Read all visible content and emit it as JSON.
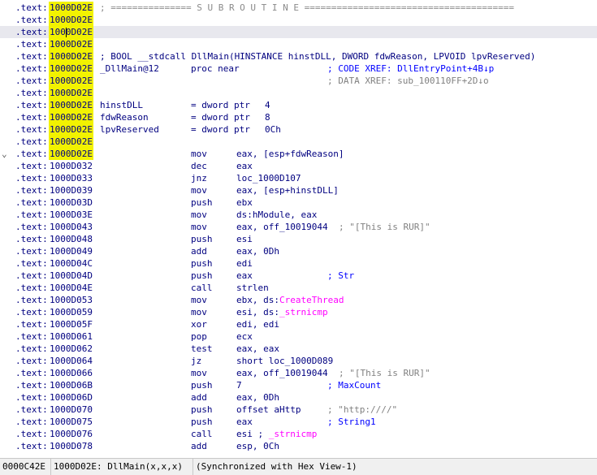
{
  "listing": {
    "lines": [
      {
        "seg": ".text:",
        "addr": "1000D02E",
        "hl": true,
        "sep": "; =============== S U B R O U T I N E ======================================="
      },
      {
        "seg": ".text:",
        "addr": "1000D02E",
        "hl": true
      },
      {
        "seg": ".text:",
        "addr": "1000D02E",
        "hl": true,
        "current": true
      },
      {
        "seg": ".text:",
        "addr": "1000D02E",
        "hl": true
      },
      {
        "seg": ".text:",
        "addr": "1000D02E",
        "hl": true,
        "name": "; BOOL __stdcall DllMain(HINSTANCE hinstDLL, DWORD fdwReason, LPVOID lpvReserved)",
        "nameColor": "#000080"
      },
      {
        "seg": ".text:",
        "addr": "1000D02E",
        "hl": true,
        "name": "_DllMain@12",
        "mnem": "proc near",
        "cmt": "; CODE XREF: DllEntryPoint+4B↓p",
        "cmtClass": "cmt-blue",
        "cmtLeft": 403
      },
      {
        "seg": ".text:",
        "addr": "1000D02E",
        "hl": true,
        "cmt": "; DATA XREF: sub_100110FF+2D↓o",
        "cmtClass": "cmt-gray",
        "cmtLeft": 403
      },
      {
        "seg": ".text:",
        "addr": "1000D02E",
        "hl": true
      },
      {
        "seg": ".text:",
        "addr": "1000D02E",
        "hl": true,
        "name": "hinstDLL",
        "mnem": "= dword ptr",
        "ops": "4",
        "opsLeft": 326
      },
      {
        "seg": ".text:",
        "addr": "1000D02E",
        "hl": true,
        "name": "fdwReason",
        "mnem": "= dword ptr",
        "ops": "8",
        "opsLeft": 326
      },
      {
        "seg": ".text:",
        "addr": "1000D02E",
        "hl": true,
        "name": "lpvReserved",
        "mnem": "= dword ptr",
        "ops": "0Ch",
        "opsLeft": 326
      },
      {
        "seg": ".text:",
        "addr": "1000D02E",
        "hl": true
      },
      {
        "seg": ".text:",
        "addr": "1000D02E",
        "hl": true,
        "mnem": "mov",
        "ops": "eax, [esp+fdwReason]",
        "arrow": true
      },
      {
        "seg": ".text:",
        "addr": "1000D032",
        "mnem": "dec",
        "ops": "eax"
      },
      {
        "seg": ".text:",
        "addr": "1000D033",
        "mnem": "jnz",
        "ops": "loc_1000D107"
      },
      {
        "seg": ".text:",
        "addr": "1000D039",
        "mnem": "mov",
        "ops": "eax, [esp+hinstDLL]"
      },
      {
        "seg": ".text:",
        "addr": "1000D03D",
        "mnem": "push",
        "ops": "ebx"
      },
      {
        "seg": ".text:",
        "addr": "1000D03E",
        "mnem": "mov",
        "ops": "ds:hModule, eax"
      },
      {
        "seg": ".text:",
        "addr": "1000D043",
        "mnem": "mov",
        "ops": "eax, off_10019044",
        "cmt": "; \"[This is RUR]\"",
        "cmtClass": "cmt-gray",
        "cmtLeft": 417
      },
      {
        "seg": ".text:",
        "addr": "1000D048",
        "mnem": "push",
        "ops": "esi"
      },
      {
        "seg": ".text:",
        "addr": "1000D049",
        "mnem": "add",
        "ops": "eax, 0Dh"
      },
      {
        "seg": ".text:",
        "addr": "1000D04C",
        "mnem": "push",
        "ops": "edi"
      },
      {
        "seg": ".text:",
        "addr": "1000D04D",
        "mnem": "push",
        "ops": "eax",
        "cmt": "; Str",
        "cmtClass": "cmt-blue",
        "cmtLeft": 403
      },
      {
        "seg": ".text:",
        "addr": "1000D04E",
        "mnem": "call",
        "ops": "strlen"
      },
      {
        "seg": ".text:",
        "addr": "1000D053",
        "mnem": "mov",
        "ops": "ebx, ds:",
        "ext": "CreateThread"
      },
      {
        "seg": ".text:",
        "addr": "1000D059",
        "mnem": "mov",
        "ops": "esi, ds:",
        "ext": "_strnicmp"
      },
      {
        "seg": ".text:",
        "addr": "1000D05F",
        "mnem": "xor",
        "ops": "edi, edi"
      },
      {
        "seg": ".text:",
        "addr": "1000D061",
        "mnem": "pop",
        "ops": "ecx"
      },
      {
        "seg": ".text:",
        "addr": "1000D062",
        "mnem": "test",
        "ops": "eax, eax"
      },
      {
        "seg": ".text:",
        "addr": "1000D064",
        "mnem": "jz",
        "ops": "short loc_1000D089"
      },
      {
        "seg": ".text:",
        "addr": "1000D066",
        "mnem": "mov",
        "ops": "eax, off_10019044",
        "cmt": "; \"[This is RUR]\"",
        "cmtClass": "cmt-gray",
        "cmtLeft": 417
      },
      {
        "seg": ".text:",
        "addr": "1000D06B",
        "mnem": "push",
        "ops": "7",
        "cmt": "; MaxCount",
        "cmtClass": "cmt-blue",
        "cmtLeft": 403
      },
      {
        "seg": ".text:",
        "addr": "1000D06D",
        "mnem": "add",
        "ops": "eax, 0Dh"
      },
      {
        "seg": ".text:",
        "addr": "1000D070",
        "mnem": "push",
        "ops": "offset aHttp",
        "cmt": "; \"http:////\"",
        "cmtClass": "cmt-gray",
        "cmtLeft": 403
      },
      {
        "seg": ".text:",
        "addr": "1000D075",
        "mnem": "push",
        "ops": "eax",
        "cmt": "; String1",
        "cmtClass": "cmt-blue",
        "cmtLeft": 403
      },
      {
        "seg": ".text:",
        "addr": "1000D076",
        "mnem": "call",
        "ops": "esi ; ",
        "ext": "_strnicmp"
      },
      {
        "seg": ".text:",
        "addr": "1000D078",
        "mnem": "add",
        "ops": "esp, 0Ch"
      }
    ]
  },
  "statusbar": {
    "offset": "0000C42E",
    "location": "1000D02E: DllMain(x,x,x)",
    "sync": "(Synchronized with Hex View-1)"
  },
  "colors": {
    "highlight": "#f2f200",
    "current_line": "#e8e8ee",
    "code": "#000080",
    "comment_blue": "#0000ff",
    "comment_gray": "#808080",
    "extern": "#ff00ff"
  }
}
